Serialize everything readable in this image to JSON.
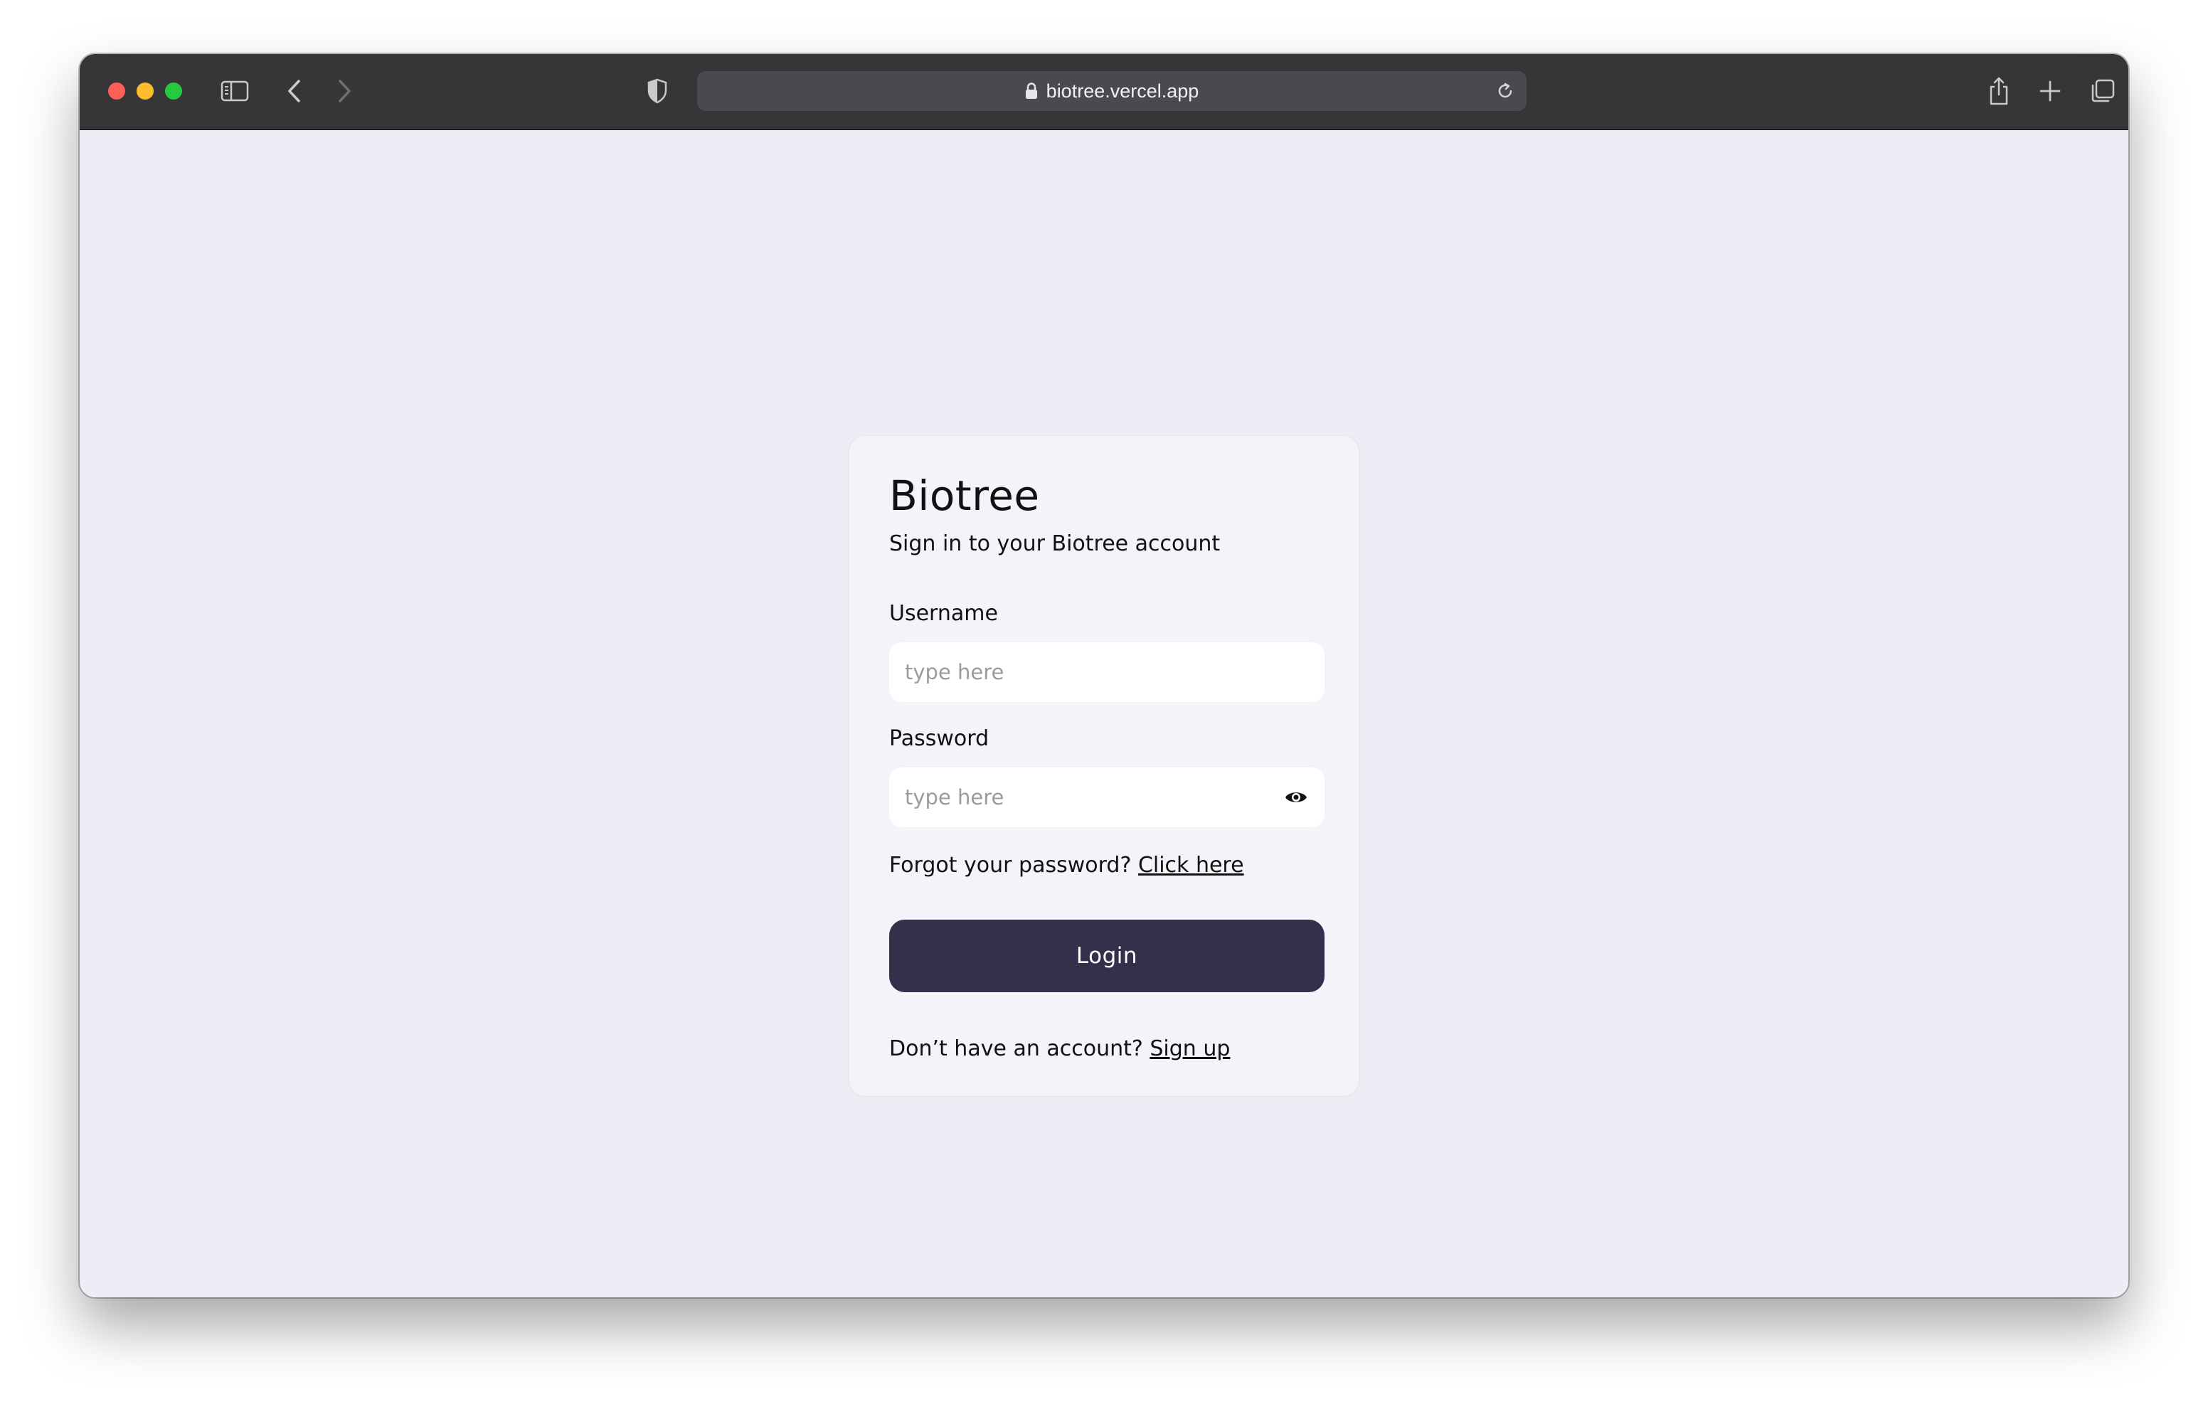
{
  "browser": {
    "url": "biotree.vercel.app",
    "icons": {
      "sidebar": "sidebar-icon",
      "back": "chevron-left-icon",
      "forward": "chevron-right-icon",
      "privacy": "shield-icon",
      "lock": "lock-icon",
      "reload": "reload-icon",
      "share": "share-icon",
      "new_tab": "plus-icon",
      "tab_overview": "tabs-icon"
    },
    "colors": {
      "toolbar": "#363538",
      "close": "#fe5f57",
      "minimize": "#febc2e",
      "maximize": "#28c840"
    }
  },
  "login": {
    "brand": "Biotree",
    "subtitle": "Sign in to your Biotree account",
    "username": {
      "label": "Username",
      "placeholder": "type here",
      "value": ""
    },
    "password": {
      "label": "Password",
      "placeholder": "type here",
      "value": "",
      "toggle_icon": "eye-icon"
    },
    "forgot": {
      "text": "Forgot your password?",
      "link": "Click here"
    },
    "submit_label": "Login",
    "signup": {
      "text": "Don’t have an account?",
      "link": "Sign up"
    },
    "colors": {
      "page_background": "#ecedf5",
      "card_background": "#f3f4f9",
      "button": "#33304b"
    }
  }
}
